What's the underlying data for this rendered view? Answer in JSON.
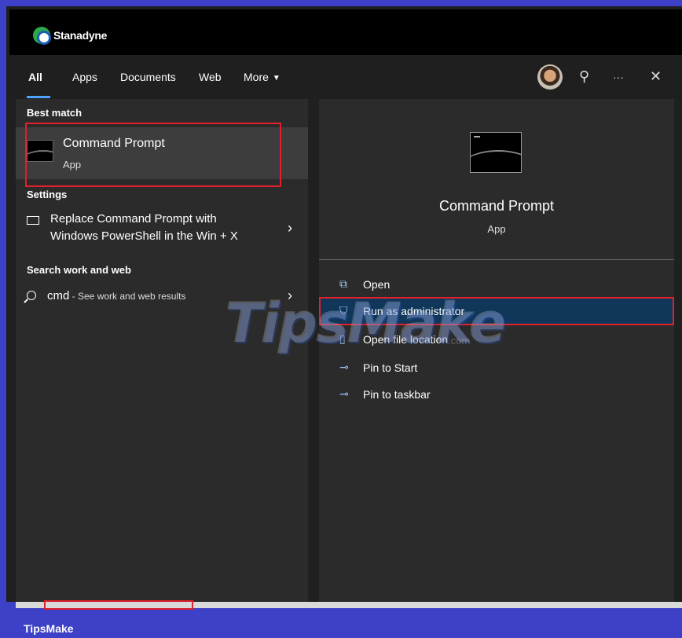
{
  "brand": {
    "name": "Stanadyne"
  },
  "tabs": {
    "all": "All",
    "apps": "Apps",
    "documents": "Documents",
    "web": "Web",
    "more": "More",
    "more_caret": "▼"
  },
  "header_icons": {
    "feedback": "⚲",
    "more": "···",
    "close": "✕"
  },
  "left": {
    "best_match_header": "Best match",
    "best_match": {
      "title": "Command Prompt",
      "subtitle": "App"
    },
    "settings_header": "Settings",
    "settings_item": {
      "line1": "Replace Command Prompt with",
      "line2": "Windows PowerShell in the Win + X"
    },
    "search_header": "Search work and web",
    "search_item": {
      "query": "cmd",
      "suffix": " - See work and web results"
    },
    "chevron": "›"
  },
  "right": {
    "title": "Command Prompt",
    "subtitle": "App",
    "actions": [
      {
        "label": "Open",
        "icon": "open-icon",
        "glyph": "⧉"
      },
      {
        "label": "Run as administrator",
        "icon": "shield-run-icon",
        "glyph": "⛉"
      },
      {
        "label": "Open file location",
        "icon": "file-location-icon",
        "glyph": "▯"
      },
      {
        "label": "Pin to Start",
        "icon": "pin-icon",
        "glyph": "⊸"
      },
      {
        "label": "Pin to taskbar",
        "icon": "pin-icon",
        "glyph": "⊸"
      }
    ]
  },
  "watermark": {
    "text": "TipsMake",
    "small": ".com"
  },
  "footer": {
    "label": "TipsMake"
  },
  "colors": {
    "accent": "#4ea3ff",
    "highlight": "#e0202a",
    "selected": "#10365a",
    "border": "#3c41c8"
  }
}
